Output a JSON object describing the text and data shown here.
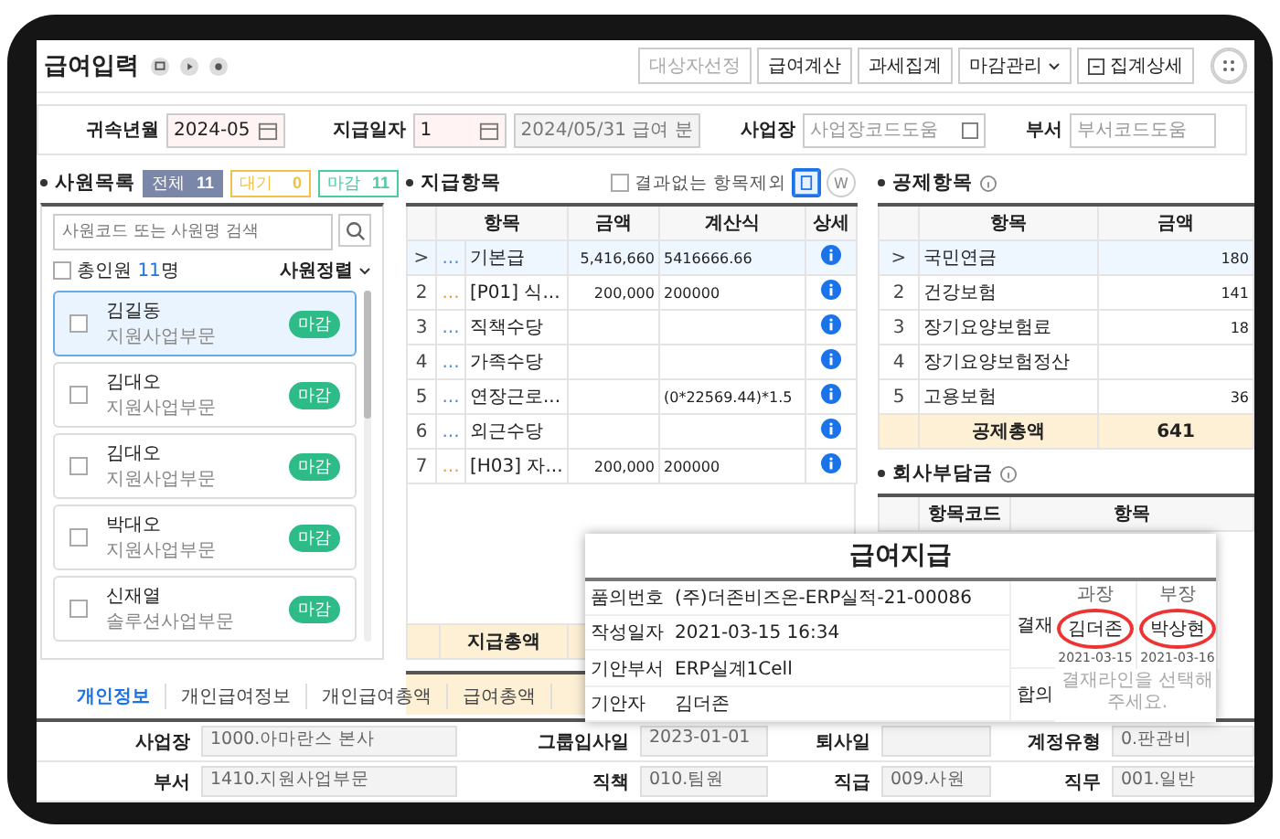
{
  "page": {
    "title": "급여입력"
  },
  "toolbar": [
    {
      "label": "대상자선정",
      "disabled": true,
      "kind": "plain"
    },
    {
      "label": "급여계산",
      "disabled": false,
      "kind": "plain"
    },
    {
      "label": "과세집계",
      "disabled": false,
      "kind": "plain"
    },
    {
      "label": "마감관리",
      "disabled": false,
      "kind": "dropdown"
    },
    {
      "label": "집계상세",
      "disabled": false,
      "kind": "icon"
    }
  ],
  "filters": [
    {
      "label": "귀속년월",
      "kind": "date",
      "value": "2024-05",
      "required": true
    },
    {
      "label": "지급일자",
      "kind": "date",
      "value": "1",
      "extra": "2024/05/31 급여 분",
      "required": true
    },
    {
      "label": "사업장",
      "kind": "code",
      "placeholder": "사업장코드도움",
      "required": false
    },
    {
      "label": "부서",
      "kind": "code",
      "placeholder": "부서코드도움",
      "required": false
    }
  ],
  "employees": {
    "title": "사원목록",
    "counts": [
      {
        "label": "전체",
        "count": "11",
        "selected": true,
        "color": "#7b87a8"
      },
      {
        "label": "대기",
        "count": "0",
        "selected": false,
        "color": "#f0c24a"
      },
      {
        "label": "마감",
        "count": "11",
        "selected": false,
        "color": "#4ccaa0"
      }
    ],
    "search_placeholder": "사원코드 또는 사원명 검색",
    "total_label": "총인원",
    "total_count": "11",
    "total_unit": "명",
    "total_checked": false,
    "sort": "사원정렬",
    "items": [
      {
        "name": "김길동",
        "dept": "지원사업부문",
        "status": "마감",
        "selected": true,
        "checked": false
      },
      {
        "name": "김대오",
        "dept": "지원사업부문",
        "status": "마감",
        "selected": false,
        "checked": false
      },
      {
        "name": "김대오",
        "dept": "지원사업부문",
        "status": "마감",
        "selected": false,
        "checked": false
      },
      {
        "name": "박대오",
        "dept": "지원사업부문",
        "status": "마감",
        "selected": false,
        "checked": false
      },
      {
        "name": "신재열",
        "dept": "솔루션사업부문",
        "status": "마감",
        "selected": false,
        "checked": false
      }
    ]
  },
  "pay_items": {
    "title": "지급항목",
    "exclude_label": "결과없는 항목제외",
    "exclude_checked": false,
    "view_modes": [
      {
        "kind": "doc",
        "selected": true
      },
      {
        "kind": "w",
        "label": "W",
        "selected": false
      }
    ],
    "columns": [
      "항목",
      "금액",
      "계산식",
      "상세"
    ],
    "rows": [
      {
        "no": ">",
        "dots": "...",
        "color": "#4a90e2",
        "name": "기본급",
        "amount": "5,416,660",
        "formula": "5416666.66",
        "selected": true
      },
      {
        "no": "2",
        "dots": "...",
        "color": "#f0a030",
        "name": "[P01] 식...",
        "amount": "200,000",
        "formula": "200000",
        "selected": false
      },
      {
        "no": "3",
        "dots": "...",
        "color": "#4a90e2",
        "name": "직책수당",
        "selected": false
      },
      {
        "no": "4",
        "dots": "...",
        "color": "#4a90e2",
        "name": "가족수당",
        "selected": false
      },
      {
        "no": "5",
        "dots": "...",
        "color": "#4a90e2",
        "name": "연장근로...",
        "formula": "(0*22569.44)*1.5",
        "selected": false
      },
      {
        "no": "6",
        "dots": "...",
        "color": "#4a90e2",
        "name": "외근수당",
        "selected": false
      },
      {
        "no": "7",
        "dots": "...",
        "color": "#f0a030",
        "name": "[H03] 자...",
        "amount": "200,000",
        "formula": "200000",
        "selected": false
      }
    ],
    "total_label": "지급총액"
  },
  "deductions": {
    "title": "공제항목",
    "columns": [
      "항목",
      "금액"
    ],
    "rows": [
      {
        "no": ">",
        "name": "국민연금",
        "amount": "180",
        "selected": true
      },
      {
        "no": "2",
        "name": "건강보험",
        "amount": "141",
        "selected": false
      },
      {
        "no": "3",
        "name": "장기요양보험료",
        "amount": "18",
        "selected": false
      },
      {
        "no": "4",
        "name": "장기요양보험정산",
        "selected": false
      },
      {
        "no": "5",
        "name": "고용보험",
        "amount": "36",
        "selected": false
      }
    ],
    "total_label": "공제총액",
    "total_amount": "641"
  },
  "company": {
    "title": "회사부담금",
    "columns": [
      "항목코드",
      "항목"
    ]
  },
  "tabs": [
    {
      "label": "개인정보",
      "selected": true
    },
    {
      "label": "개인급여정보",
      "selected": false
    },
    {
      "label": "개인급여총액",
      "selected": false
    },
    {
      "label": "급여총액",
      "selected": false
    }
  ],
  "form": [
    [
      {
        "label": "사업장",
        "value": "1000.아마란스 본사"
      },
      {
        "label": "그룹입사일",
        "value": "2023-01-01"
      },
      {
        "label": "퇴사일"
      },
      {
        "label": "계정유형",
        "value": "0.판관비"
      }
    ],
    [
      {
        "label": "부서",
        "value": "1410.지원사업부문"
      },
      {
        "label": "직책",
        "value": "010.팀원"
      },
      {
        "label": "직급",
        "value": "009.사원"
      },
      {
        "label": "직무",
        "value": "001.일반"
      }
    ]
  ],
  "popup": {
    "title": "급여지급",
    "info": [
      {
        "label": "품의번호",
        "value": "(주)더존비즈온-ERP실적-21-00086"
      },
      {
        "label": "작성일자",
        "value": "2021-03-15 16:34"
      },
      {
        "label": "기안부서",
        "value": "ERP실계1Cell"
      },
      {
        "label": "기안자",
        "value": "김더존"
      }
    ],
    "approval": {
      "label": "결재",
      "steps": [
        {
          "role": "과장",
          "stamp": "김더존",
          "date": "2021-03-15"
        },
        {
          "role": "부장",
          "stamp": "박상현",
          "date": "2021-03-16"
        }
      ]
    },
    "agreement": {
      "label": "합의",
      "placeholder": "결재라인을 선택해주세요."
    }
  }
}
